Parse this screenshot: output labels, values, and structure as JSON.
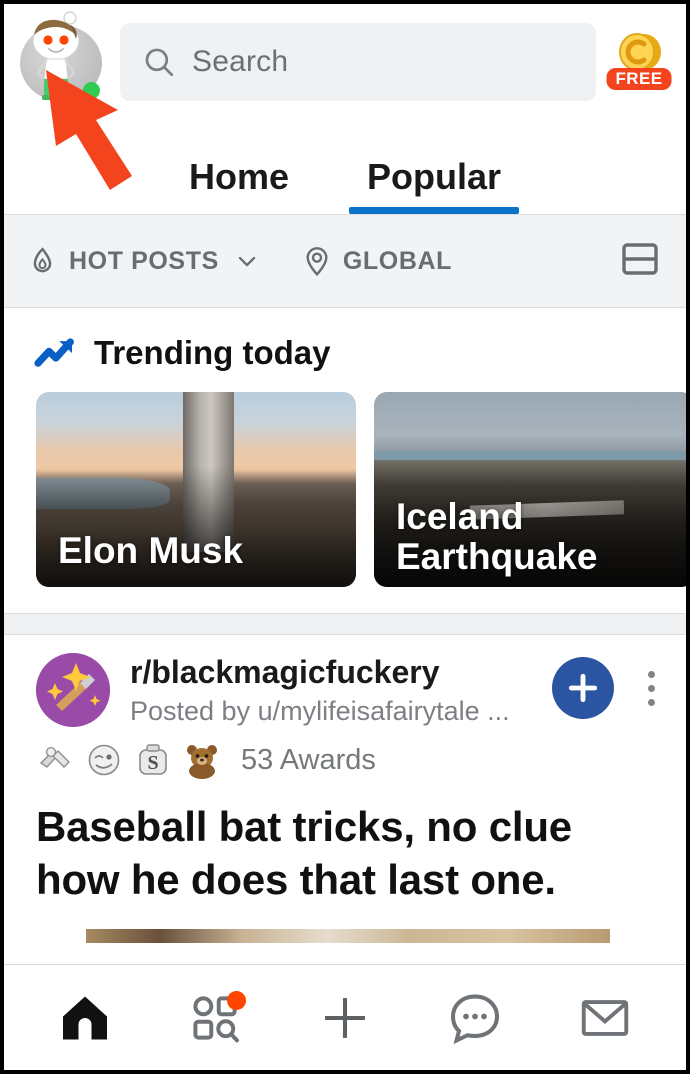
{
  "app": {
    "name": "Reddit",
    "accent_blue": "#0c73ca",
    "accent_orange": "#ff4500",
    "join_blue": "#2b55a1",
    "status_green": "#2fcc52",
    "annotation_red": "#f4441e"
  },
  "header": {
    "avatar": {
      "icon": "snoo-avatar",
      "online": true,
      "status_color": "#2fcc52"
    },
    "search": {
      "placeholder": "Search",
      "icon": "search-icon"
    },
    "coin": {
      "icon": "coin-icon",
      "badge_label": "FREE",
      "badge_color": "#f4441e"
    }
  },
  "tabs": [
    {
      "label": "Home",
      "active": false
    },
    {
      "label": "Popular",
      "active": true
    }
  ],
  "filter_bar": {
    "sort": {
      "label": "HOT POSTS",
      "icon": "flame-icon",
      "chevron": "chevron-down-icon"
    },
    "region": {
      "label": "GLOBAL",
      "icon": "location-pin-icon"
    },
    "layout_toggle": {
      "icon": "card-view-icon"
    }
  },
  "trending": {
    "heading": "Trending today",
    "heading_icon": "trending-up-icon",
    "cards": [
      {
        "label": "Elon Musk"
      },
      {
        "label": "Iceland\nEarthquake",
        "line1": "Iceland",
        "line2": "Earthquake"
      }
    ]
  },
  "post": {
    "subreddit": "r/blackmagicfuckery",
    "subreddit_icon": "magic-wand-icon",
    "posted_by": "Posted by u/mylifeisafairytale ...",
    "join_button": {
      "icon": "plus-icon",
      "label": "Join"
    },
    "overflow": {
      "icon": "kebab-menu-icon"
    },
    "awards_count": "53 Awards",
    "award_icons": [
      "award-silver-arms",
      "award-silver-face",
      "award-silver-s",
      "award-bear"
    ],
    "title": "Baseball bat tricks, no clue how he does that last one."
  },
  "bottom_nav": [
    {
      "icon": "home-icon",
      "active": true,
      "badge": false
    },
    {
      "icon": "discover-grid-icon",
      "active": false,
      "badge": true
    },
    {
      "icon": "plus-icon",
      "active": false,
      "badge": false
    },
    {
      "icon": "chat-bubble-icon",
      "active": false,
      "badge": false
    },
    {
      "icon": "inbox-envelope-icon",
      "active": false,
      "badge": false
    }
  ],
  "annotation": {
    "type": "arrow",
    "points_to": "avatar",
    "color": "#f4441e"
  }
}
